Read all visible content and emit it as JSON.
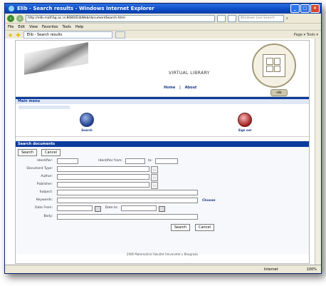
{
  "window": {
    "title": "Elib - Search results - Windows Internet Explorer"
  },
  "browser": {
    "address": "http://elib.matf.bg.ac.rs:8080/ElibWeb/documentSearch.html",
    "live_search_placeholder": "Windows Live Search",
    "menu": [
      "File",
      "Edit",
      "View",
      "Favorites",
      "Tools",
      "Help"
    ],
    "tab_title": "Elib - Search results",
    "command_bar": "Page ▾  Tools ▾"
  },
  "site": {
    "title": "VIRTUAL LIBRARY",
    "nav": {
      "home": "Home",
      "separator": "|",
      "about": "About"
    },
    "seal_badge_text": "elib"
  },
  "main_menu": {
    "header": "Main menu",
    "items": [
      {
        "label": "Search"
      },
      {
        "label": "Sign out"
      }
    ]
  },
  "search_documents": {
    "header": "Search documents",
    "top_buttons": {
      "search": "Search",
      "cancel": "Cancel"
    },
    "labels": {
      "identifier": "Identifier:",
      "identifier_from": "Identifier from:",
      "to": "to:",
      "document_type": "Document Type:",
      "author": "Author:",
      "publisher": "Publisher:",
      "subject": "Subject:",
      "keywords": "Keywords:",
      "choose": "Choose",
      "date_from": "Date From:",
      "date_to": "Date to:",
      "body": "Body:"
    },
    "bottom_buttons": {
      "search": "Search",
      "cancel": "Cancel"
    }
  },
  "footer": {
    "text": "2006 Matematicki fakultet Univerzitet u Beogradu"
  },
  "status_bar": {
    "zone": "Internet",
    "zoom": "100%"
  }
}
